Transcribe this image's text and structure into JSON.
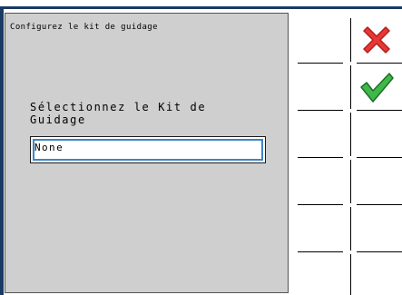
{
  "dialog": {
    "title": "Configurez le kit de guidage",
    "prompt": "Sélectionnez le Kit de Guidage",
    "selected_kit": "None"
  },
  "softkeys": [
    {
      "icon": "cancel-x-icon",
      "color": "#e53935"
    },
    {
      "icon": "confirm-check-icon",
      "color": "#2e9e3a"
    },
    {
      "icon": ""
    },
    {
      "icon": ""
    },
    {
      "icon": ""
    },
    {
      "icon": ""
    }
  ],
  "colors": {
    "dialog_bg": "#cfcfcf",
    "frame_blue": "#1a3a66",
    "focus_blue": "#3d85c6"
  }
}
